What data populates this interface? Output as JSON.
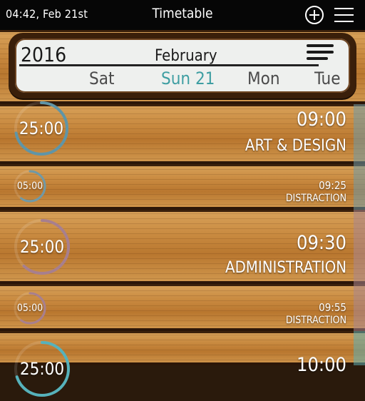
{
  "status_bar": {
    "time": "04:42, Feb 21st",
    "title": "Timetable"
  },
  "calendar": {
    "year": "2016",
    "month": "February",
    "days": [
      "Sat",
      "Sun 21",
      "Mon",
      "Tue"
    ],
    "selected_day": "Sun 21"
  },
  "events": [
    {
      "duration": "25:00",
      "time": "09:00",
      "name": "ART & DESIGN",
      "ring_color": "#5f95a7",
      "progress": 0.72
    },
    {
      "duration": "05:00",
      "time": "09:25",
      "name": "DISTRACTION",
      "ring_color": "#6f99a6",
      "progress": 0.6
    },
    {
      "duration": "25:00",
      "time": "09:30",
      "name": "ADMINISTRATION",
      "ring_color": "#a77f8e",
      "progress": 0.62
    },
    {
      "duration": "05:00",
      "time": "09:55",
      "name": "DISTRACTION",
      "ring_color": "#a77f8e",
      "progress": 0.6
    },
    {
      "duration": "25:00",
      "time": "10:00",
      "name": "",
      "ring_color": "#56b2bb",
      "progress": 0.7
    }
  ],
  "colors": {
    "accent_teal": "#3e9ea2",
    "status_bar_bg": "#060606",
    "wood": "#c8893f"
  },
  "icons": {
    "add": "plus-circle-icon",
    "menu": "hamburger-menu-icon",
    "calendar_lines": "stripes-icon"
  }
}
